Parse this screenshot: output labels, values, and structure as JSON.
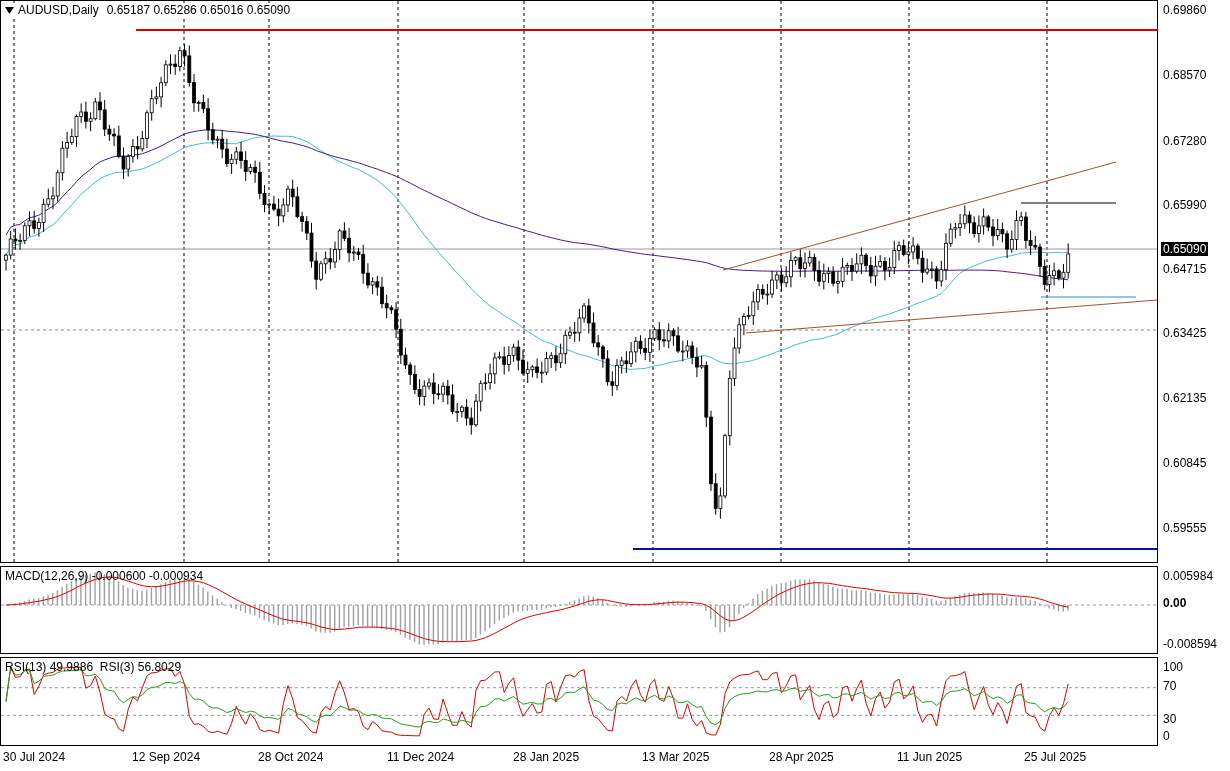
{
  "header": {
    "symbol": "AUDUSD,Daily",
    "ohlc": "0.65187 0.65286 0.65016 0.65090"
  },
  "price_axis": [
    {
      "label": "0.69860",
      "kind": "tick"
    },
    {
      "label": "0.68570",
      "kind": "tick"
    },
    {
      "label": "0.67280",
      "kind": "tick"
    },
    {
      "label": "0.65990",
      "kind": "tick"
    },
    {
      "label": "0.65090",
      "kind": "current"
    },
    {
      "label": "0.64715",
      "kind": "tick"
    },
    {
      "label": "0.63425",
      "kind": "tick"
    },
    {
      "label": "0.62135",
      "kind": "tick"
    },
    {
      "label": "0.60845",
      "kind": "tick"
    },
    {
      "label": "0.59555",
      "kind": "tick"
    }
  ],
  "macd": {
    "title": "MACD(12,26,9) -0.000600 -0.000934",
    "axis": [
      {
        "label": "0.005984",
        "kind": "tick"
      },
      {
        "label": "0.00",
        "kind": "zero"
      },
      {
        "label": "-0.008594",
        "kind": "tick"
      }
    ]
  },
  "rsi": {
    "title": "RSI(13) 49.9886  RSI(3) 56.8029",
    "axis": [
      "100",
      "70",
      "30",
      "0"
    ]
  },
  "time_axis": [
    "30 Jul 2024",
    "12 Sep 2024",
    "28 Oct 2024",
    "11 Dec 2024",
    "28 Jan 2025",
    "13 Mar 2025",
    "28 Apr 2025",
    "11 Jun 2025",
    "25 Jul 2025"
  ]
}
